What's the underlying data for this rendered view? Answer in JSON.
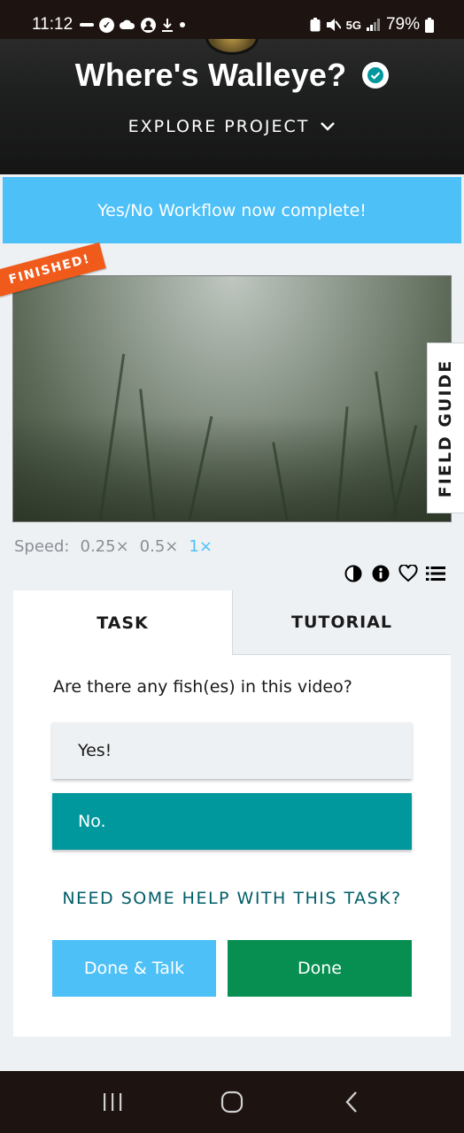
{
  "status_bar": {
    "time": "11:12",
    "left_icons": [
      "notification-icon",
      "check-circle-icon",
      "cloud-icon",
      "account-icon",
      "download-icon",
      "dot-icon"
    ],
    "network": "5G",
    "battery": "79%"
  },
  "header": {
    "title": "Where's Walleye?",
    "explore_label": "EXPLORE PROJECT"
  },
  "banner": {
    "text": "Yes/No Workflow now complete!"
  },
  "video": {
    "ribbon": "FINISHED!"
  },
  "field_guide": {
    "label": "FIELD GUIDE"
  },
  "speed": {
    "label": "Speed:",
    "options": [
      "0.25×",
      "0.5×",
      "1×"
    ],
    "selected": "1×"
  },
  "meta_tools": [
    "contrast-icon",
    "info-icon",
    "heart-icon",
    "collection-list-icon"
  ],
  "task_panel": {
    "tabs": {
      "task": "TASK",
      "tutorial": "TUTORIAL"
    },
    "question": "Are there any fish(es) in this video?",
    "answers": {
      "yes": "Yes!",
      "no": "No."
    },
    "selected_answer": "No.",
    "help_link": "NEED SOME HELP WITH THIS TASK?",
    "buttons": {
      "done_talk": "Done & Talk",
      "done": "Done"
    }
  },
  "colors": {
    "banner": "#4dc0f8",
    "selected_answer": "#00979d",
    "done_button": "#078f52",
    "done_talk_button": "#4dc0f8",
    "ribbon": "#f05a1a",
    "help_link": "#005d69"
  },
  "nav_bar": {
    "buttons": [
      "recent-apps-icon",
      "home-icon",
      "back-icon"
    ]
  }
}
